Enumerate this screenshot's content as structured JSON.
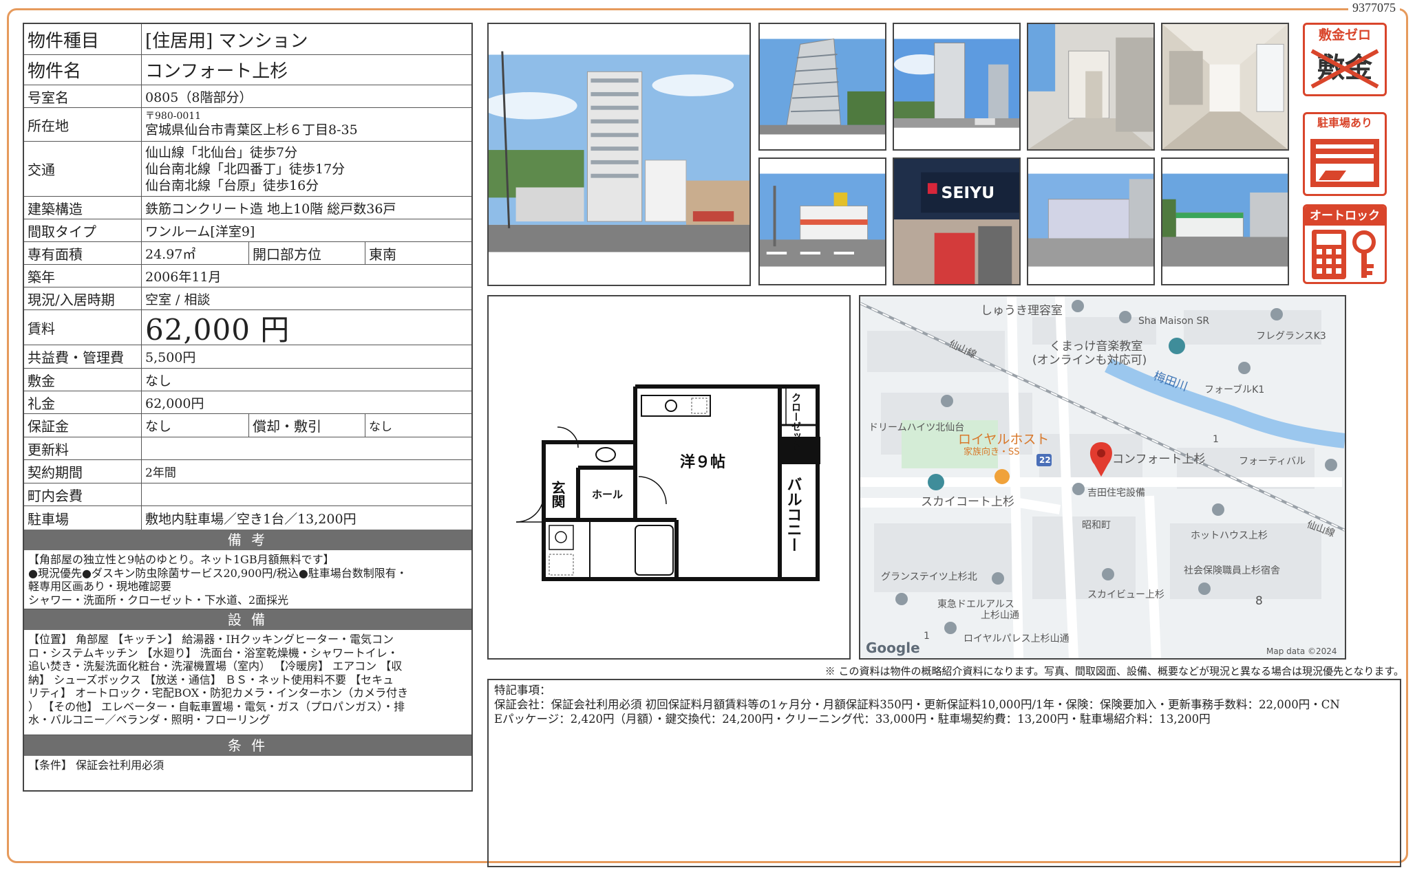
{
  "doc_id": "9377075",
  "property": {
    "type_label": "物件種目",
    "type_value": "[住居用] マンション",
    "name_label": "物件名",
    "name_value": "コンフォート上杉",
    "room_label": "号室名",
    "room_value": "0805（8階部分）",
    "address_label": "所在地",
    "postal": "〒980-0011",
    "address": "宮城県仙台市青葉区上杉６丁目8-35",
    "transport_label": "交通",
    "transport": [
      "仙山線「北仙台」徒歩7分",
      "仙台南北線「北四番丁」徒歩17分",
      "仙台南北線「台原」徒歩16分"
    ],
    "structure_label": "建築構造",
    "structure_value": "鉄筋コンクリート造 地上10階 総戸数36戸",
    "layout_label": "間取タイプ",
    "layout_value": "ワンルーム[洋室9]",
    "area_label": "専有面積",
    "area_value": "24.97㎡",
    "facing_label": "開口部方位",
    "facing_value": "東南",
    "built_label": "築年",
    "built_value": "2006年11月",
    "status_label": "現況/入居時期",
    "status_value": "空室 / 相談",
    "rent_label": "賃料",
    "rent_value": "62,000 円",
    "common_label": "共益費・管理費",
    "common_value": "5,500円",
    "deposit_label": "敷金",
    "deposit_value": "なし",
    "key_money_label": "礼金",
    "key_money_value": "62,000円",
    "guarantee_label": "保証金",
    "guarantee_value": "なし",
    "amort_label": "償却・敷引",
    "amort_value": "なし",
    "renewal_label": "更新料",
    "renewal_value": "",
    "contract_label": "契約期間",
    "contract_value": "2年間",
    "town_fee_label": "町内会費",
    "town_fee_value": "",
    "parking_label": "駐車場",
    "parking_value": "敷地内駐車場／空き1台／13,200円"
  },
  "remarks": {
    "title": "備 考",
    "lines": [
      "【角部屋の独立性と9帖のゆとり。ネット1GB月額無料です】",
      "●現況優先●ダスキン防虫除菌サービス20,900円/税込●駐車場台数制限有・",
      "軽専用区画あり・現地確認要",
      "シャワー・洗面所・クローゼット・下水道、2面採光"
    ]
  },
  "equipment": {
    "title": "設 備",
    "lines": [
      "【位置】 角部屋 【キッチン】 給湯器・IHクッキングヒーター・電気コン",
      "ロ・システムキッチン 【水廻り】 洗面台・浴室乾燥機・シャワートイレ・",
      "追い焚き・洗髪洗面化粧台・洗濯機置場（室内） 【冷暖房】 エアコン 【収",
      "納】 シューズボックス 【放送・通信】 ＢＳ・ネット使用料不要 【セキュ",
      "リティ】 オートロック・宅配BOX・防犯カメラ・インターホン（カメラ付き",
      "） 【その他】 エレベーター・自転車置場・電気・ガス（プロパンガス）・排",
      "水・バルコニー／ベランダ・照明・フローリング"
    ]
  },
  "conditions": {
    "title": "条 件",
    "lines": [
      "【条件】 保証会社利用必須"
    ]
  },
  "badges": {
    "deposit_zero": "敷金ゼロ",
    "deposit_crossed": "敷金",
    "parking": "駐車場あり",
    "autolock": "オートロック"
  },
  "floorplan": {
    "room": "洋９帖",
    "closet": "クローゼット",
    "balcony": "バルコニー",
    "entrance": "玄関",
    "hall": "ホール"
  },
  "map": {
    "labels": {
      "l1": "しゅうき理容室",
      "l2": "Sha Maison SR",
      "l3": "フレグランスK3",
      "l4": "くまっけ音楽教室",
      "l5": "(オンラインも対応可)",
      "l6": "仙山線",
      "l7": "梅田川",
      "l8": "フォーブルK1",
      "l9": "ドリームハイツ北仙台",
      "l10": "ロイヤルホスト",
      "l11": "家族向き・SS",
      "l12": "22",
      "l13": "コンフォート上杉",
      "l14": "フォーティバル",
      "l15": "吉田住宅設備",
      "l16": "スカイコート上杉",
      "l17": "昭和町",
      "l18": "1",
      "l19": "ホットハウス上杉",
      "l20": "仙山線",
      "l21": "グランステイツ上杉北",
      "l22": "社会保険職員上杉宿舎",
      "l23": "スカイビュー上杉",
      "l24": "東急ドエルアルス",
      "l25": "上杉山通",
      "l26": "8",
      "l27": "1",
      "l28": "ロイヤルパレス上杉山通"
    },
    "google": "Google",
    "credit": "Map data ©2024"
  },
  "disclaimer": "※ この資料は物件の概略紹介資料になります。写真、間取図面、設備、概要などが現況と異なる場合は現況優先となります。",
  "notes": {
    "title": "特記事項：",
    "lines": [
      "保証会社：保証会社利用必須 初回保証料月額賃料等の1ヶ月分・月額保証料350円・更新保証料10,000円/1年・保険：保険要加入・更新事務手数料：22,000円・CN",
      "Eパッケージ：2,420円（月額）・鍵交換代：24,200円・クリーニング代：33,000円・駐車場契約費：13,200円・駐車場紹介料：13,200円"
    ]
  }
}
